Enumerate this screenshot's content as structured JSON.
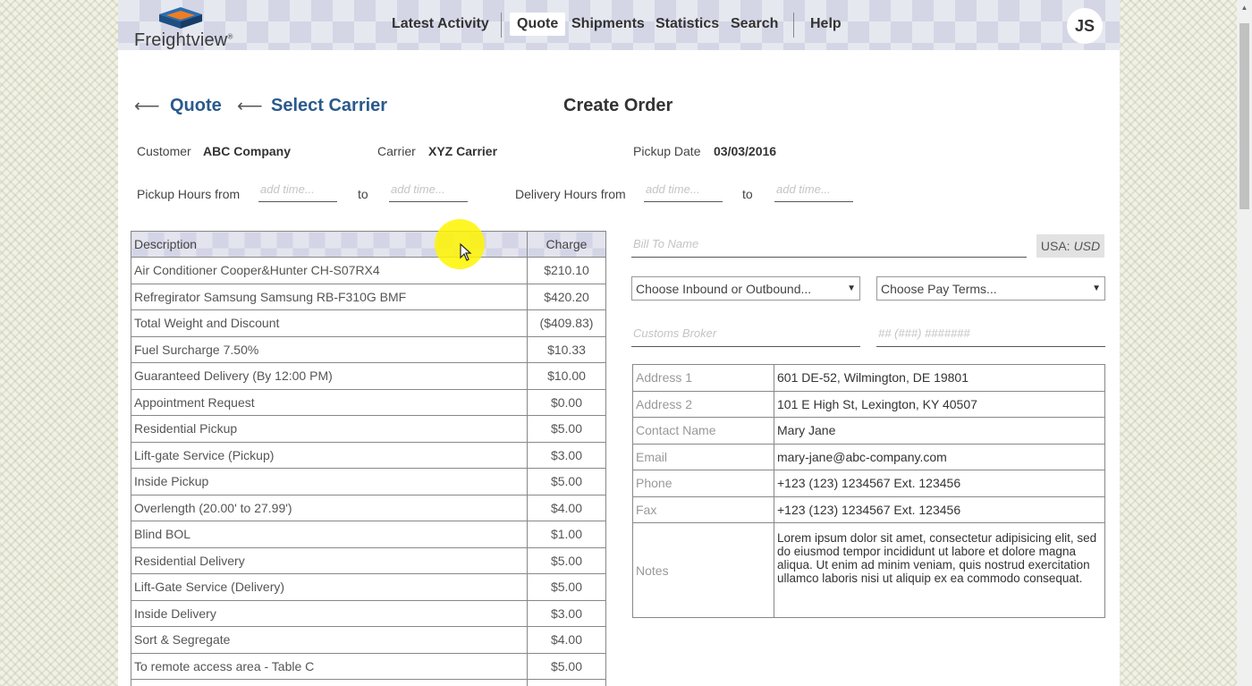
{
  "app": {
    "logo_text": "Freightview",
    "brand_color": "#2a5a8c"
  },
  "nav": {
    "latest_activity": "Latest Activity",
    "quote": "Quote",
    "shipments": "Shipments",
    "statistics": "Statistics",
    "search": "Search",
    "help": "Help",
    "user_initials": "JS"
  },
  "breadcrumb": {
    "step1": "Quote",
    "step2": "Select Carrier",
    "arrow": "⟵"
  },
  "page_title": "Create Order",
  "info": {
    "customer_label": "Customer",
    "customer_value": "ABC Company",
    "carrier_label": "Carrier",
    "carrier_value": "XYZ Carrier",
    "pickup_date_label": "Pickup Date",
    "pickup_date_value": "03/03/2016"
  },
  "hours": {
    "pickup_label": "Pickup Hours from",
    "delivery_label": "Delivery Hours from",
    "to_label": "to",
    "placeholder": "add time..."
  },
  "charges": {
    "headers": {
      "description": "Description",
      "charge": "Charge"
    },
    "rows": [
      {
        "description": "Air Conditioner Cooper&Hunter CH-S07RX4",
        "charge": "$210.10"
      },
      {
        "description": "Refregirator Samsung Samsung RB-F310G BMF",
        "charge": "$420.20"
      },
      {
        "description": "Total Weight and Discount",
        "charge": "($409.83)"
      },
      {
        "description": "Fuel Surcharge 7.50%",
        "charge": "$10.33"
      },
      {
        "description": "Guaranteed Delivery (By 12:00 PM)",
        "charge": "$10.00"
      },
      {
        "description": "Appointment Request",
        "charge": "$0.00"
      },
      {
        "description": "Residential Pickup",
        "charge": "$5.00"
      },
      {
        "description": "Lift-gate Service (Pickup)",
        "charge": "$3.00"
      },
      {
        "description": "Inside Pickup",
        "charge": "$5.00"
      },
      {
        "description": "Overlength (20.00' to 27.99')",
        "charge": "$4.00"
      },
      {
        "description": "Blind BOL",
        "charge": "$1.00"
      },
      {
        "description": "Residential Delivery",
        "charge": "$5.00"
      },
      {
        "description": "Lift-Gate Service (Delivery)",
        "charge": "$5.00"
      },
      {
        "description": "Inside Delivery",
        "charge": "$3.00"
      },
      {
        "description": "Sort & Segregate",
        "charge": "$4.00"
      },
      {
        "description": "To remote access area - Table C",
        "charge": "$5.00"
      },
      {
        "description": "",
        "charge": ""
      }
    ]
  },
  "billing": {
    "bill_to_placeholder": "Bill To Name",
    "currency_country": "USA:",
    "currency_code": "USD",
    "direction_select": "Choose Inbound or Outbound...",
    "pay_terms_select": "Choose Pay Terms...",
    "customs_broker_placeholder": "Customs Broker",
    "phone_placeholder": "## (###) #######"
  },
  "address": {
    "address1_label": "Address 1",
    "address1_value": "601 DE-52, Wilmington, DE 19801",
    "address2_label": "Address 2",
    "address2_value": "101 E High St, Lexington, KY 40507",
    "contact_label": "Contact Name",
    "contact_value": "Mary Jane",
    "email_label": "Email",
    "email_value": "mary-jane@abc-company.com",
    "phone_label": "Phone",
    "phone_value": "+123 (123) 1234567 Ext. 123456",
    "fax_label": "Fax",
    "fax_value": "+123 (123) 1234567 Ext. 123456",
    "notes_label": "Notes",
    "notes_value": "Lorem ipsum dolor sit amet, consectetur adipisicing elit, sed do eiusmod tempor incididunt ut labore et dolore magna aliqua. Ut enim ad minim veniam, quis nostrud exercitation ullamco laboris nisi ut aliquip ex ea commodo consequat."
  }
}
